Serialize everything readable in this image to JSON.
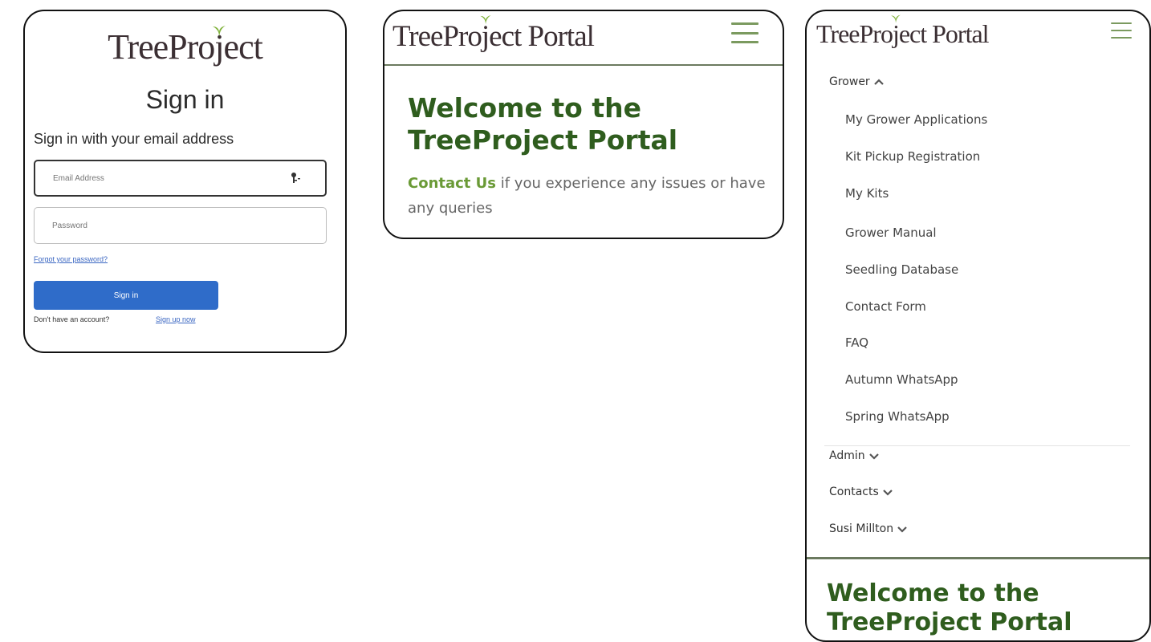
{
  "colors": {
    "accent_green": "#2f5d1e",
    "link_green": "#6a9a36",
    "button_blue": "#2f6cc9",
    "border": "#111111"
  },
  "signin_panel": {
    "logo_text_a": "TreePro",
    "logo_text_b": "j",
    "logo_text_c": "ect",
    "title": "Sign in",
    "subtitle": "Sign in with your email address",
    "email_placeholder": "Email Address",
    "password_placeholder": "Password",
    "forgot_link": "Forgot your password?",
    "signin_button": "Sign in",
    "no_account_text": "Don't have an account?",
    "signup_link": "Sign up now"
  },
  "portal_home": {
    "logo_text_a": "TreePro",
    "logo_text_b": "j",
    "logo_text_c": "ect Portal",
    "welcome": "Welcome to the TreeProject Portal",
    "contact_link": "Contact Us",
    "contact_rest": " if you experience any issues or have any queries"
  },
  "portal_menu": {
    "logo_text_a": "TreePro",
    "logo_text_b": "j",
    "logo_text_c": "ect Portal",
    "grower_label": "Grower",
    "grower_items": [
      "My Grower Applications",
      "Kit Pickup Registration",
      "My Kits",
      "Grower Manual",
      "Seedling Database",
      "Contact Form",
      "FAQ",
      "Autumn WhatsApp",
      "Spring WhatsApp"
    ],
    "admin_label": "Admin",
    "contacts_label": "Contacts",
    "user_label": "Susi Millton",
    "welcome": "Welcome to the TreeProject Portal"
  }
}
